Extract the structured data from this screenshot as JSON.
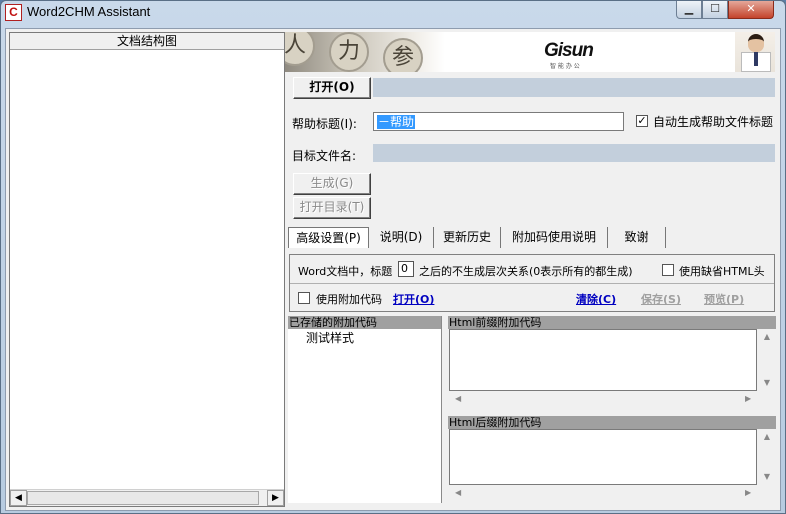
{
  "window": {
    "title": "Word2CHM Assistant",
    "icon_glyph": "C",
    "controls": {
      "minimize": "▁",
      "maximize": "☐",
      "close": "✕"
    }
  },
  "doc_tree": {
    "header": "文档结构图",
    "scroll_left": "◀",
    "scroll_right": "▶"
  },
  "banner": {
    "brand": "Gisun",
    "brand_sub": "智 能 办 公",
    "chess_pieces": [
      "人",
      "力",
      "参"
    ]
  },
  "form": {
    "open_button": "打开(O)",
    "help_title_label": "帮助标题(I):",
    "help_title_value": "－帮助",
    "auto_title_checkbox": "自动生成帮助文件标题",
    "auto_title_checked": true,
    "target_file_label": "目标文件名:",
    "generate_button": "生成(G)",
    "open_toc_button": "打开目录(T)"
  },
  "tabs": [
    {
      "label": "高级设置(P)",
      "active": true
    },
    {
      "label": "说明(D)",
      "active": false
    },
    {
      "label": "更新历史",
      "active": false
    },
    {
      "label": "附加码使用说明",
      "active": false
    },
    {
      "label": "致谢",
      "active": false
    }
  ],
  "advanced": {
    "heading_prefix": "Word文档中，标题",
    "heading_level": "0",
    "heading_suffix": "之后的不生成层次关系(0表示所有的都生成)",
    "default_html_head": "使用缺省HTML头",
    "default_html_head_checked": false,
    "use_extra_code": "使用附加代码",
    "use_extra_code_checked": false,
    "open_link": "打开(O)",
    "clear_link": "清除(C)",
    "save_link": "保存(S)",
    "preview_link": "预览(P)"
  },
  "code_panels": {
    "saved_header": "已存储的附加代码",
    "saved_items": [
      "测试样式"
    ],
    "prefix_header": "Html前缀附加代码",
    "suffix_header": "Html后缀附加代码"
  },
  "colors": {
    "selection": "#3399ff",
    "link": "#0000c0",
    "readonly_bar": "#c3cfdc",
    "close_button": "#c4432b"
  }
}
